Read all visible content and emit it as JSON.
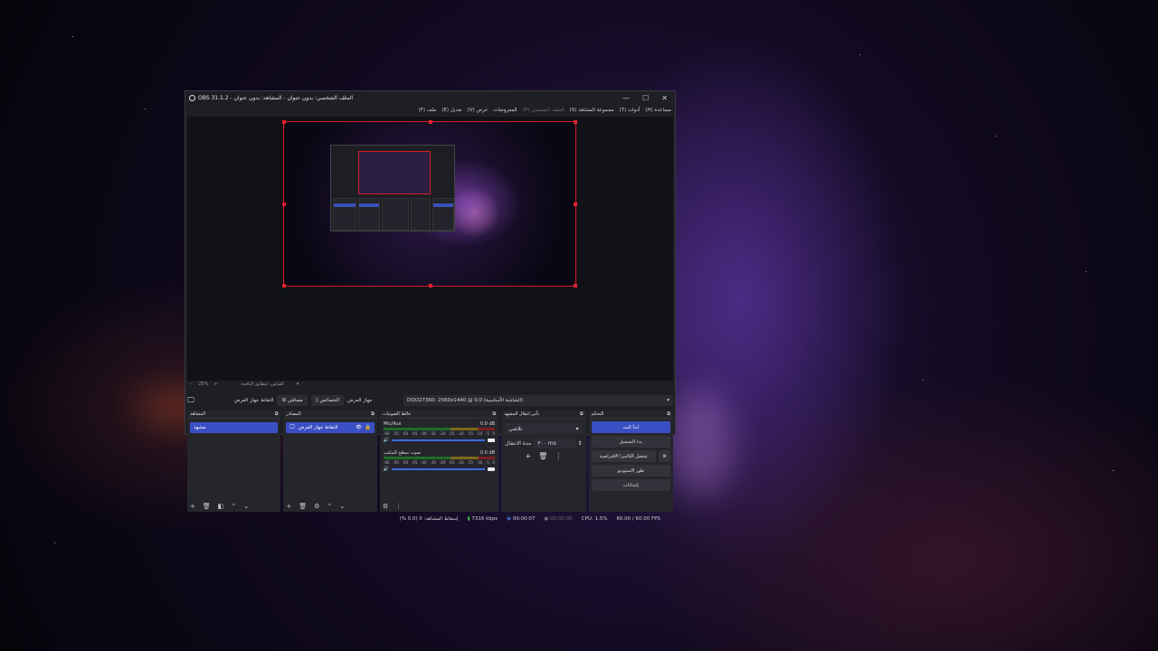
{
  "window": {
    "title": "OBS 31.1.2 - الملف الشخصي: بدون عنوان - المشاهد: بدون عنوان",
    "minimize": "—",
    "maximize": "☐",
    "close": "✕"
  },
  "menu": [
    {
      "label": "ملف (F)"
    },
    {
      "label": "تعديل (E)"
    },
    {
      "label": "عرض (V)"
    },
    {
      "label": "المعروضات"
    },
    {
      "label": "الملف الشخصي (P)",
      "dim": true
    },
    {
      "label": "مجموعة المشاهد (S)"
    },
    {
      "label": "أدوات (T)"
    },
    {
      "label": "مساعدة (H)"
    }
  ],
  "zoom": {
    "minus": "−",
    "value": "25%",
    "plus": "+",
    "fit": "القياس: ليطابق النافذة",
    "chev": "▾"
  },
  "source_bar": {
    "capture_label": "التقاط جهاز العرض",
    "filters_label": "مصافي",
    "properties_label": "الخصائص",
    "display_label": "جهاز العرض",
    "display_value": "DQO27360: 2560x1440 @ 0,0 (الشاشة الأساسية)",
    "chev": "▾"
  },
  "scenes": {
    "title": "المشاهد",
    "items": [
      "مشهد"
    ]
  },
  "sources": {
    "title": "المصادر",
    "items": [
      "التقاط جهاز العرض"
    ]
  },
  "mixer": {
    "title": "خالط الصوتيات",
    "channels": [
      {
        "name": "Mic/Aux",
        "db": "0.0 dB"
      },
      {
        "name": "صوت سطح المكتب",
        "db": "0.0 dB"
      }
    ],
    "ticks": [
      "-60",
      "-55",
      "-50",
      "-45",
      "-40",
      "-35",
      "-30",
      "-25",
      "-20",
      "-15",
      "-10",
      "-5",
      "0"
    ]
  },
  "transitions": {
    "title": "تأثير انتقال المشهد",
    "type": "تلاشي",
    "duration_label": "مدة الانتقال",
    "duration_value": "٣٠٠ ms"
  },
  "controls": {
    "title": "التحكم",
    "buttons": [
      {
        "label": "ابدأ البث",
        "primary": true
      },
      {
        "label": "بدء التسجيل"
      },
      {
        "label": "تشغيل الكاميرا الافتراضية"
      },
      {
        "label": "طور الاستوديو"
      },
      {
        "label": "إعدادات"
      }
    ]
  },
  "status": {
    "dropped": "إسقاط المشاهد: 0 (0.0 %)",
    "bitrate": "7316 kbps",
    "stream_time": "00:00:07",
    "rec_time": "00:00:00",
    "cpu": "CPU: 1.5%",
    "fps": "60.00 / 60.00 FPS"
  }
}
